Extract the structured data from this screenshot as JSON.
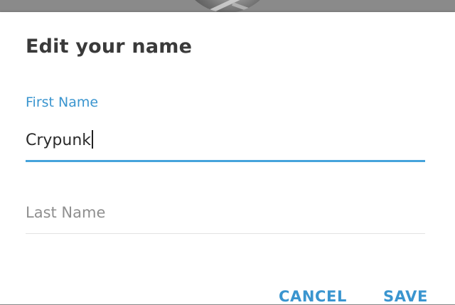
{
  "dialog": {
    "title": "Edit your name",
    "first_name": {
      "label": "First Name",
      "value": "Crypunk"
    },
    "last_name": {
      "placeholder": "Last Name",
      "value": ""
    },
    "buttons": {
      "cancel": "CANCEL",
      "save": "SAVE"
    }
  },
  "colors": {
    "accent": "#3a95cf",
    "title_text": "#3a3a3a",
    "placeholder_text": "#8f8f8f"
  }
}
